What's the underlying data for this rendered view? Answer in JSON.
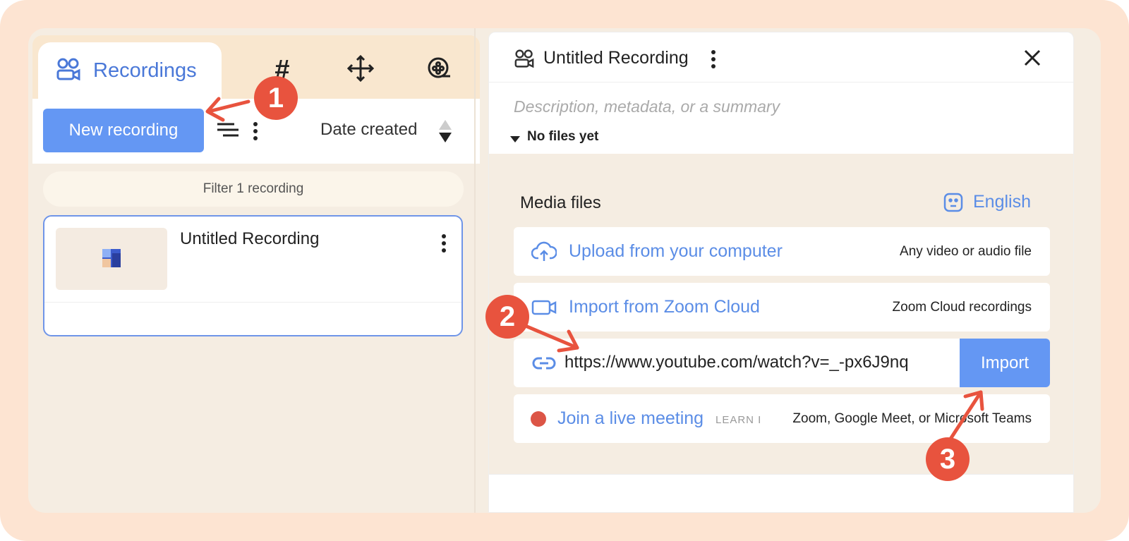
{
  "left": {
    "tab_active_label": "Recordings",
    "tab_icons": [
      "hash-icon",
      "move-icon",
      "film-reel-icon"
    ],
    "new_recording_label": "New recording",
    "sort_label": "Date created",
    "filter_label": "Filter 1 recording",
    "recordings": [
      {
        "title": "Untitled Recording"
      }
    ]
  },
  "right": {
    "title": "Untitled Recording",
    "description_placeholder": "Description, metadata, or a summary",
    "files_summary": "No files yet",
    "media_title": "Media files",
    "language": "English",
    "upload": {
      "label": "Upload from your computer",
      "hint": "Any video or audio file"
    },
    "zoom": {
      "label": "Import from Zoom Cloud",
      "hint": "Zoom Cloud recordings"
    },
    "url_import": {
      "value": "https://www.youtube.com/watch?v=_-px6J9nq",
      "button_label": "Import"
    },
    "live": {
      "label": "Join a live meeting",
      "learn": "LEARN I",
      "hint": "Zoom, Google Meet, or Microsoft Teams"
    }
  },
  "callouts": [
    "1",
    "2",
    "3"
  ],
  "colors": {
    "accent": "#6497f3",
    "callout": "#e8533e",
    "frame": "#fde4d2",
    "panel": "#f5ede2"
  }
}
